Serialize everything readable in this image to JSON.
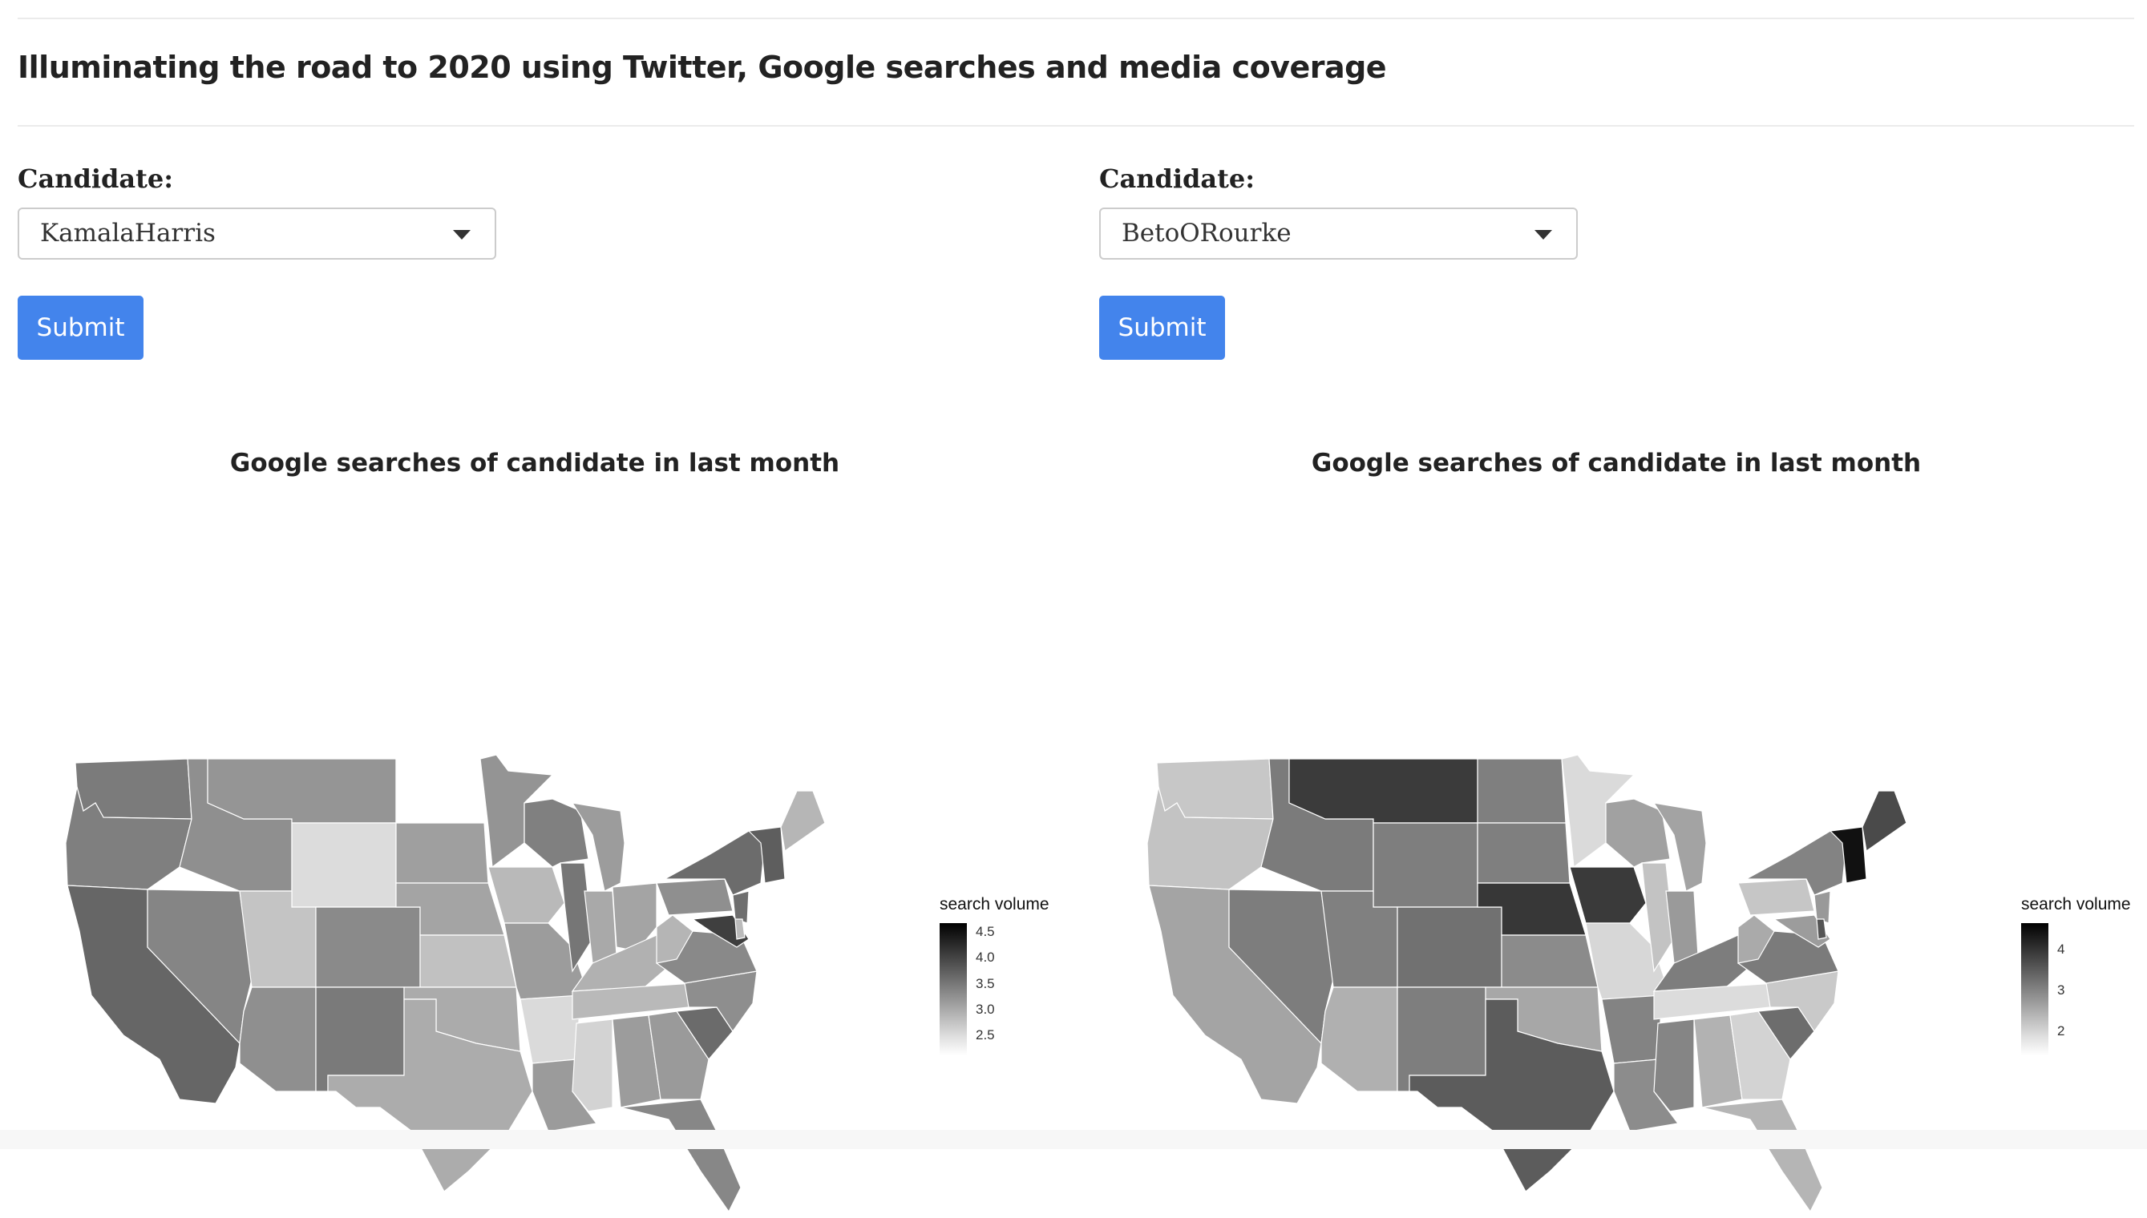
{
  "header": {
    "title": "Illuminating the road to 2020 using Twitter, Google searches and media coverage"
  },
  "panels": [
    {
      "label": "Candidate:",
      "selected": "KamalaHarris",
      "submit_label": "Submit",
      "map": {
        "title": "Google searches of candidate in last month",
        "legend_title": "search volume",
        "legend_ticks": [
          "4.5",
          "4.0",
          "3.5",
          "3.0",
          "2.5"
        ],
        "shades": {
          "WA": "#7b7b7b",
          "OR": "#7f7f7f",
          "CA": "#666666",
          "NV": "#858585",
          "ID": "#8f8f8f",
          "MT": "#959595",
          "WY": "#dcdcdc",
          "UT": "#c4c4c4",
          "AZ": "#8f8f8f",
          "CO": "#8a8a8a",
          "NM": "#7a7a7a",
          "ND": "#ffffff",
          "SD": "#9f9f9f",
          "NE": "#a4a4a4",
          "KS": "#c1c1c1",
          "OK": "#ababab",
          "TX": "#acacac",
          "MN": "#949494",
          "IA": "#b9b9b9",
          "MO": "#9c9c9c",
          "AR": "#dadada",
          "LA": "#9b9b9b",
          "WI": "#808080",
          "IL": "#767676",
          "MI": "#9c9c9c",
          "IN": "#a9a9a9",
          "OH": "#a4a4a4",
          "KY": "#b1b1b1",
          "TN": "#b9b9b9",
          "MS": "#d3d3d3",
          "AL": "#9c9c9c",
          "GA": "#9a9a9a",
          "FL": "#878787",
          "SC": "#6b6b6b",
          "NC": "#8e8e8e",
          "VA": "#898989",
          "WV": "#b5b5b5",
          "PA": "#8f8f8f",
          "NY": "#6c6c6c",
          "NJ": "#6e6e6e",
          "MD": "#3f3f3f",
          "DE": "#bbbbbb",
          "NEW": "#5e5e5e",
          "ME": "#b6b6b6"
        }
      }
    },
    {
      "label": "Candidate:",
      "selected": "BetoORourke",
      "submit_label": "Submit",
      "map": {
        "title": "Google searches of candidate in last month",
        "legend_title": "search volume",
        "legend_ticks": [
          "4",
          "3",
          "2"
        ],
        "shades": {
          "WA": "#c7c7c7",
          "OR": "#c3c3c3",
          "CA": "#a4a4a4",
          "NV": "#7d7d7d",
          "ID": "#7b7b7b",
          "MT": "#3b3b3b",
          "WY": "#7e7e7e",
          "UT": "#808080",
          "AZ": "#b0b0b0",
          "CO": "#717171",
          "NM": "#7e7e7e",
          "ND": "#7f7f7f",
          "SD": "#7f7f7f",
          "NE": "#373737",
          "KS": "#8b8b8b",
          "OK": "#a7a7a7",
          "TX": "#5c5c5c",
          "MN": "#dadada",
          "IA": "#3a3a3a",
          "MO": "#d7d7d7",
          "AR": "#838383",
          "LA": "#8c8c8c",
          "WI": "#a1a1a1",
          "IL": "#c3c3c3",
          "MI": "#a3a3a3",
          "IN": "#9a9a9a",
          "OH": "#ffffff",
          "KY": "#7d7d7d",
          "TN": "#dcdcdc",
          "MS": "#858585",
          "AL": "#b2b2b2",
          "GA": "#d3d3d3",
          "FL": "#b5b5b5",
          "SC": "#6d6d6d",
          "NC": "#c9c9c9",
          "VA": "#7b7b7b",
          "WV": "#aaaaaa",
          "PA": "#c6c6c6",
          "NY": "#838383",
          "NJ": "#999999",
          "MD": "#9c9c9c",
          "DE": "#555555",
          "NEW": "#111111",
          "ME": "#4a4a4a"
        }
      }
    }
  ]
}
